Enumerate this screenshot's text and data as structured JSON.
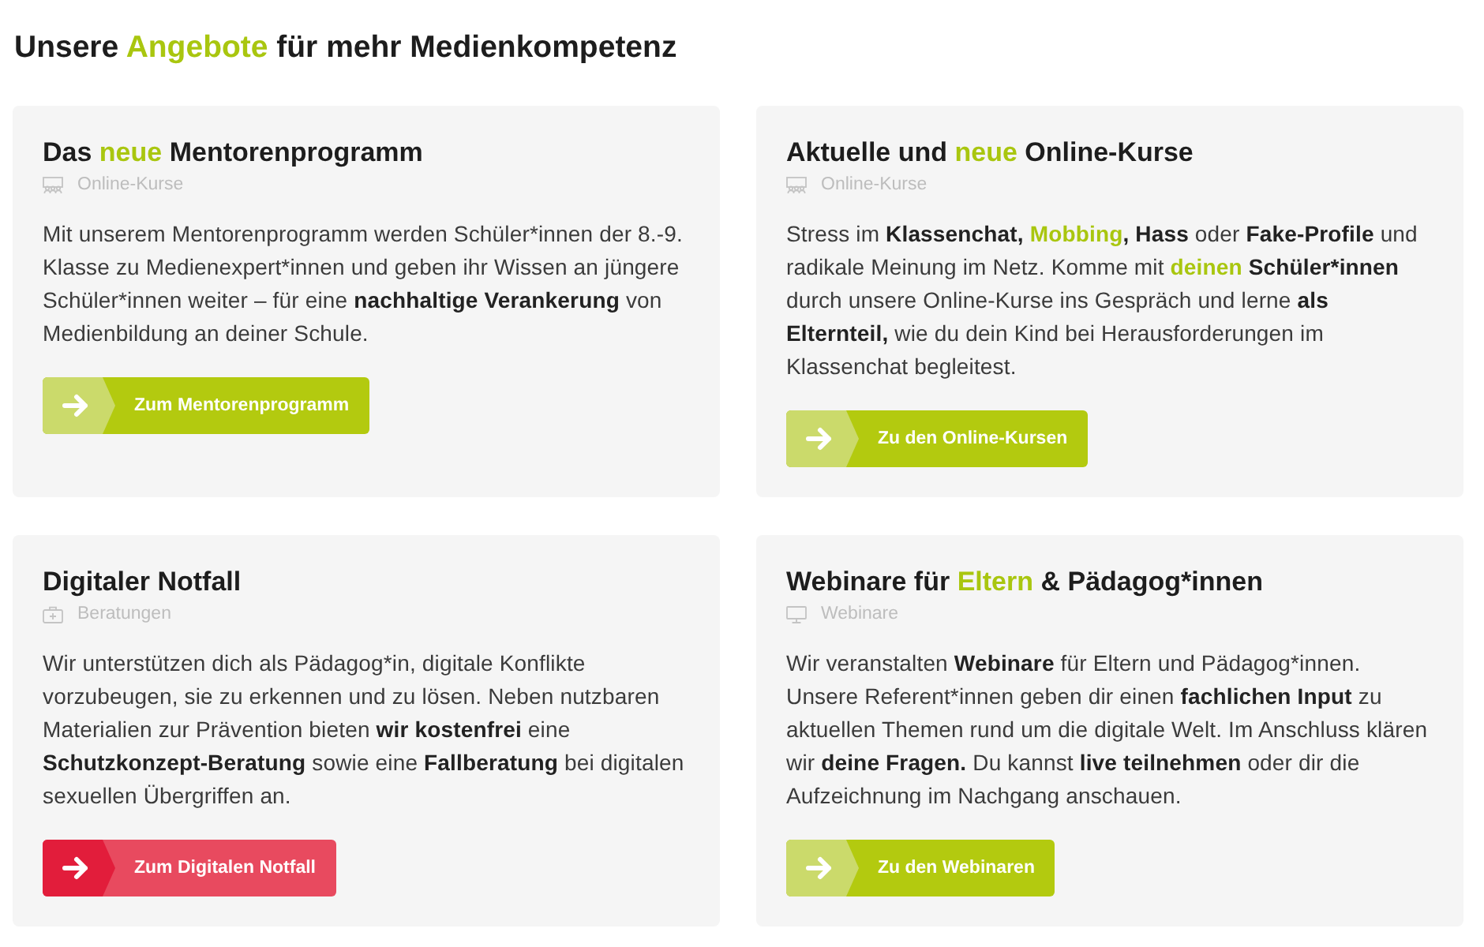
{
  "heading": [
    {
      "text": "Unsere ",
      "kind": "plain"
    },
    {
      "text": "Angebote",
      "kind": "accent"
    },
    {
      "text": " für mehr Medienkompetenz",
      "kind": "plain"
    }
  ],
  "cards": [
    {
      "title": [
        {
          "text": "Das ",
          "kind": "plain"
        },
        {
          "text": "neue",
          "kind": "accent"
        },
        {
          "text": " Mentorenprogramm",
          "kind": "plain"
        }
      ],
      "category": {
        "kind": "online-course",
        "label": "Online-Kurse"
      },
      "body": [
        {
          "text": "Mit unserem Mentorenprogramm werden Schüler*innen der 8.-9. Klasse zu Medienexpert*innen und geben ihr Wissen an jüngere Schüler*innen weiter – für eine ",
          "kind": "plain"
        },
        {
          "text": "nachhaltige Verankerung",
          "kind": "bold"
        },
        {
          "text": " von Medienbildung an deiner Schule.",
          "kind": "plain"
        }
      ],
      "button": {
        "label": "Zum Mentorenprogramm",
        "color": "#b3ca0f",
        "arrow": {
          "color": "#cbda6b"
        }
      }
    },
    {
      "title": [
        {
          "text": "Aktuelle und ",
          "kind": "plain"
        },
        {
          "text": "neue",
          "kind": "accent"
        },
        {
          "text": " Online-Kurse",
          "kind": "plain"
        }
      ],
      "category": {
        "kind": "online-course",
        "label": "Online-Kurse"
      },
      "body": [
        {
          "text": "Stress im ",
          "kind": "plain"
        },
        {
          "text": "Klassenchat, ",
          "kind": "bold"
        },
        {
          "text": "Mobbing",
          "kind": "accent"
        },
        {
          "text": ", Hass",
          "kind": "bold"
        },
        {
          "text": " oder ",
          "kind": "plain"
        },
        {
          "text": "Fake-Profile",
          "kind": "bold"
        },
        {
          "text": " und radikale Meinung im Netz. Komme mit ",
          "kind": "plain"
        },
        {
          "text": "deinen",
          "kind": "accent"
        },
        {
          "text": " Schüler*innen",
          "kind": "bold"
        },
        {
          "text": " durch unsere Online-Kurse ins Gespräch und lerne ",
          "kind": "plain"
        },
        {
          "text": "als Elternteil,",
          "kind": "bold"
        },
        {
          "text": " wie du dein Kind bei Herausforderungen im Klassenchat begleitest.",
          "kind": "plain"
        }
      ],
      "button": {
        "label": "Zu den Online-Kursen",
        "color": "#b3ca0f",
        "arrow": {
          "color": "#cbda6b"
        }
      }
    },
    {
      "title": [
        {
          "text": "Digitaler Notfall",
          "kind": "plain"
        }
      ],
      "category": {
        "kind": "counseling",
        "label": "Beratungen"
      },
      "body": [
        {
          "text": "Wir unterstützen dich als Pädagog*in, digitale Konflikte vorzubeugen, sie zu erkennen und zu lösen. Neben nutzbaren Materialien zur Prävention bieten ",
          "kind": "plain"
        },
        {
          "text": "wir kostenfrei",
          "kind": "bold"
        },
        {
          "text": " eine ",
          "kind": "plain"
        },
        {
          "text": "Schutzkonzept-Beratung",
          "kind": "bold"
        },
        {
          "text": " sowie eine ",
          "kind": "plain"
        },
        {
          "text": "Fallberatung",
          "kind": "bold"
        },
        {
          "text": " bei digitalen sexuellen Übergriffen an.",
          "kind": "plain"
        }
      ],
      "button": {
        "label": "Zum Digitalen Notfall",
        "color": "#e84a5f",
        "arrow": {
          "color": "#e21d3b"
        }
      }
    },
    {
      "title": [
        {
          "text": "Webinare für ",
          "kind": "plain"
        },
        {
          "text": "Eltern",
          "kind": "accent"
        },
        {
          "text": " & Pädagog*innen",
          "kind": "plain"
        }
      ],
      "category": {
        "kind": "webinar",
        "label": "Webinare"
      },
      "body": [
        {
          "text": "Wir veranstalten ",
          "kind": "plain"
        },
        {
          "text": "Webinare",
          "kind": "bold"
        },
        {
          "text": " für Eltern und Pädagog*innen. Unsere Referent*innen geben dir einen ",
          "kind": "plain"
        },
        {
          "text": "fachlichen Input",
          "kind": "bold"
        },
        {
          "text": " zu aktuellen Themen rund um die digitale Welt. Im Anschluss klären wir ",
          "kind": "plain"
        },
        {
          "text": "deine Fragen.",
          "kind": "bold"
        },
        {
          "text": " Du kannst ",
          "kind": "plain"
        },
        {
          "text": "live teilnehmen",
          "kind": "bold"
        },
        {
          "text": " oder dir die Aufzeichnung im Nachgang anschauen.",
          "kind": "plain"
        }
      ],
      "button": {
        "label": "Zu den Webinaren",
        "color": "#b3ca0f",
        "arrow": {
          "color": "#cbda6b"
        }
      }
    }
  ]
}
